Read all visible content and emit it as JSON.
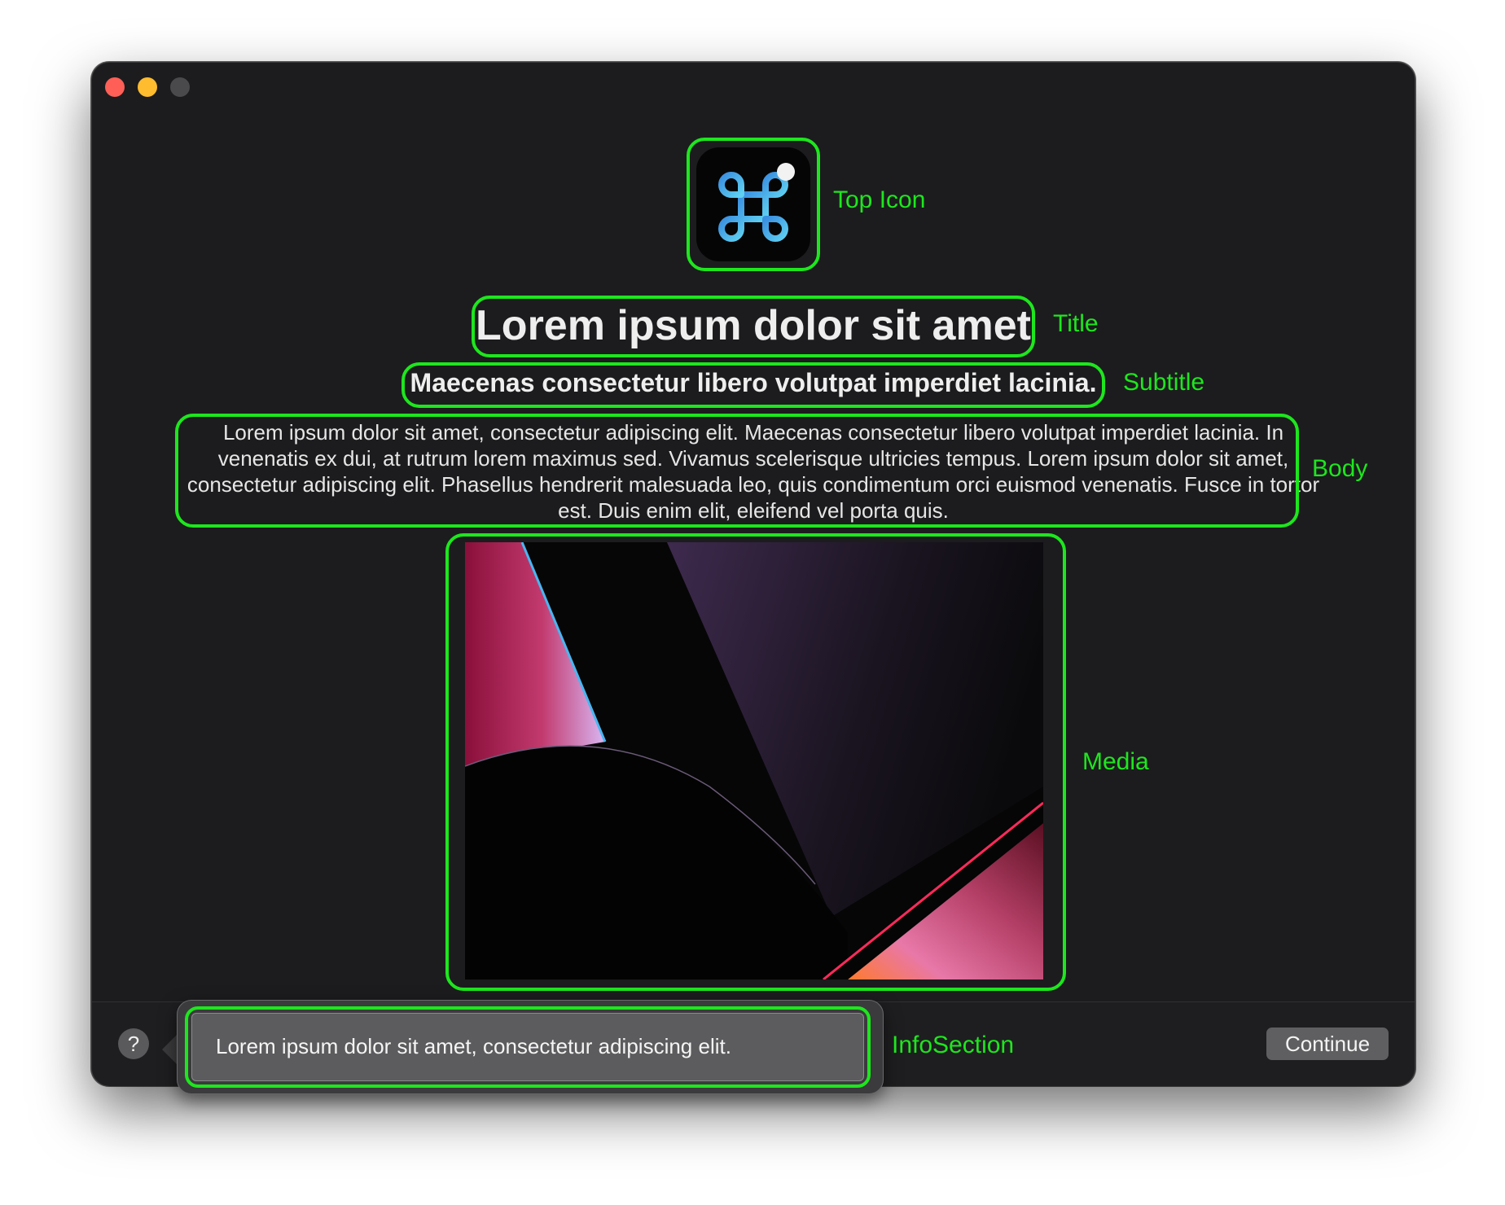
{
  "window": {
    "traffic_lights": [
      "close",
      "minimize",
      "maximize"
    ]
  },
  "content": {
    "top_icon": "command-key-icon",
    "title": "Lorem ipsum dolor sit amet",
    "subtitle": "Maecenas consectetur libero volutpat imperdiet lacinia.",
    "body": "Lorem ipsum dolor sit amet, consectetur adipiscing elit. Maecenas consectetur libero volutpat imperdiet lacinia. In venenatis ex dui, at rutrum lorem maximus sed. Vivamus scelerisque ultricies tempus. Lorem ipsum dolor sit amet, consectetur adipiscing elit. Phasellus hendrerit malesuada leo, quis condimentum orci euismod venenatis. Fusce in tortor est. Duis enim elit, eleifend vel porta quis."
  },
  "footer": {
    "help_label": "?",
    "info_text": "Lorem ipsum dolor sit amet, consectetur adipiscing elit.",
    "continue_label": "Continue"
  },
  "annotations": {
    "top_icon": "Top Icon",
    "title": "Title",
    "subtitle": "Subtitle",
    "body": "Body",
    "media": "Media",
    "info_section": "InfoSection"
  },
  "colors": {
    "window_bg": "#1c1c1e",
    "annotation": "#1ee61e",
    "close": "#ff5f57",
    "minimize": "#febc2e",
    "icon_gradient_start": "#3a8fe0",
    "icon_gradient_end": "#5fd0f0"
  }
}
